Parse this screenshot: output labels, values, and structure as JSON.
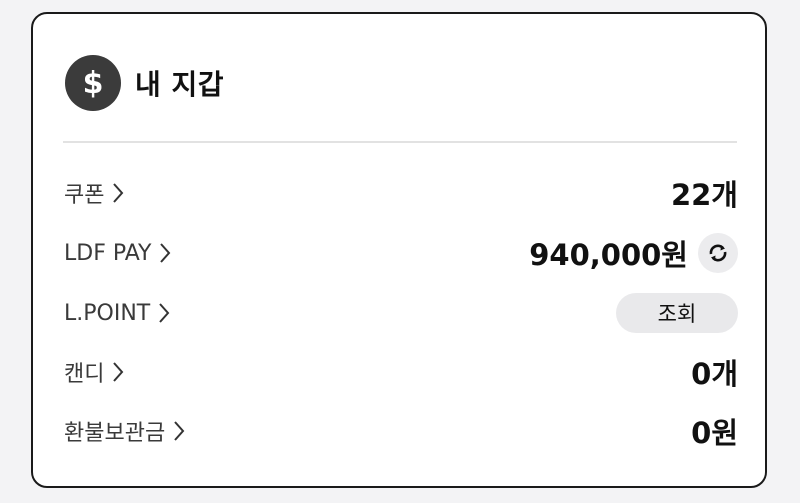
{
  "wallet": {
    "icon": "dollar-coin-icon",
    "title": "내 지갑"
  },
  "rows": [
    {
      "label": "쿠폰",
      "value": "22개"
    },
    {
      "label": "LDF PAY",
      "value": "940,000원",
      "action_icon": "refresh-icon"
    },
    {
      "label": "L.POINT",
      "button_label": "조회"
    },
    {
      "label": "캔디",
      "value": "0개"
    },
    {
      "label": "환불보관금",
      "value": "0원"
    }
  ],
  "colors": {
    "border": "#1a1a1a",
    "coin_bg": "#3b3b3b",
    "pill_bg": "#e9e9eb",
    "divider": "#e2e2e2"
  }
}
